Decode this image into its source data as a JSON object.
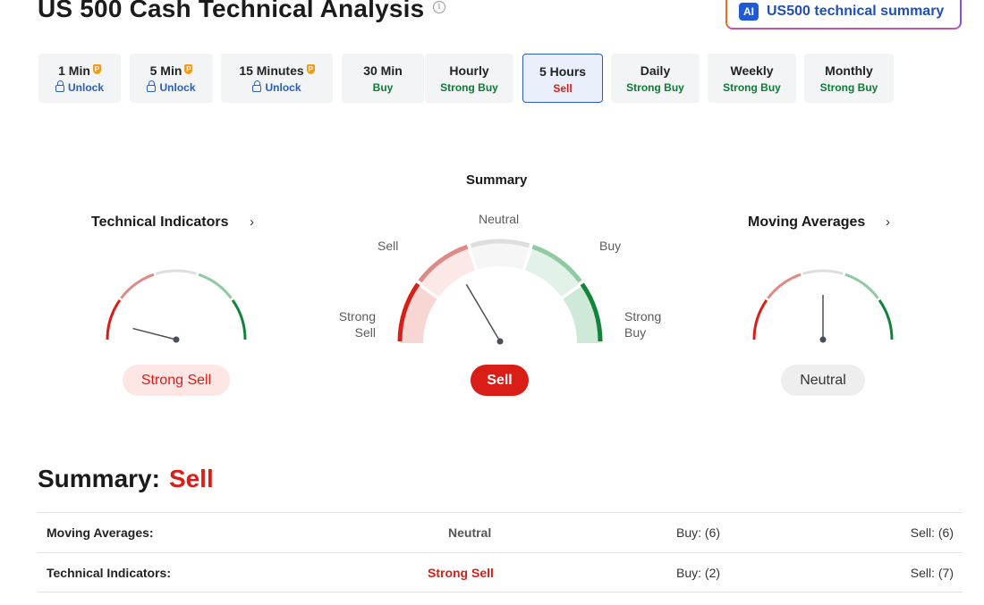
{
  "header": {
    "title": "US 500 Cash Technical Analysis",
    "info_icon": "info-icon",
    "ai_button": {
      "badge": "AI",
      "label": "US500 technical summary"
    }
  },
  "timeframes": [
    {
      "name": "1 Min",
      "value": "Unlock",
      "locked": true
    },
    {
      "name": "5 Min",
      "value": "Unlock",
      "locked": true
    },
    {
      "name": "15 Minutes",
      "value": "Unlock",
      "locked": true
    },
    {
      "name": "30 Min",
      "value": "Buy",
      "locked": false
    },
    {
      "name": "Hourly",
      "value": "Strong Buy",
      "locked": false
    },
    {
      "name": "5 Hours",
      "value": "Sell",
      "locked": false,
      "active": true
    },
    {
      "name": "Daily",
      "value": "Strong Buy",
      "locked": false
    },
    {
      "name": "Weekly",
      "value": "Strong Buy",
      "locked": false
    },
    {
      "name": "Monthly",
      "value": "Strong Buy",
      "locked": false
    }
  ],
  "gauges": {
    "technical": {
      "title": "Technical Indicators",
      "result": "Strong Sell",
      "needle_level": 0.08
    },
    "summary": {
      "title": "Summary",
      "result": "Sell",
      "needle_level": 0.33,
      "labels": {
        "strong_sell": [
          "Strong",
          "Sell"
        ],
        "sell": "Sell",
        "neutral": "Neutral",
        "buy": "Buy",
        "strong_buy": [
          "Strong",
          "Buy"
        ]
      }
    },
    "moving": {
      "title": "Moving Averages",
      "result": "Neutral",
      "needle_level": 0.5
    }
  },
  "summary": {
    "label": "Summary:",
    "value": "Sell",
    "rows": [
      {
        "name": "Moving Averages:",
        "value": "Neutral",
        "buy": "Buy: (6)",
        "sell": "Sell: (6)"
      },
      {
        "name": "Technical Indicators:",
        "value": "Strong Sell",
        "buy": "Buy: (2)",
        "sell": "Sell: (7)"
      }
    ]
  },
  "colors": {
    "strong_sell": "#d91e18",
    "sell": "#de8a86",
    "neutral": "#dedede",
    "buy": "#8fcaa3",
    "strong_buy": "#11843a",
    "accent": "#2a5fb4"
  }
}
